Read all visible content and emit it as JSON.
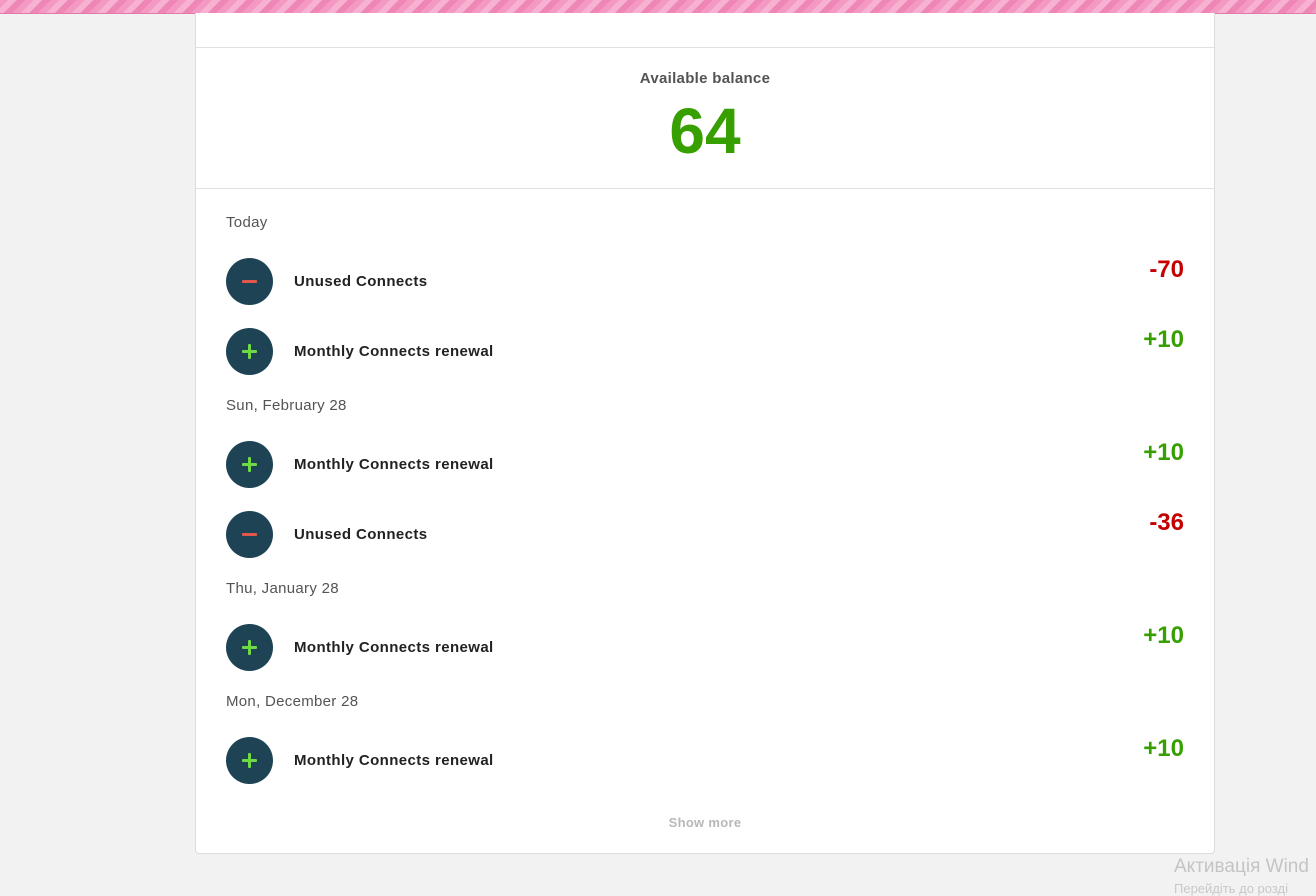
{
  "balance": {
    "label": "Available balance",
    "value": "64"
  },
  "groups": [
    {
      "date": "Today",
      "items": [
        {
          "type": "minus",
          "label": "Unused Connects",
          "amount": "-70"
        },
        {
          "type": "plus",
          "label": "Monthly Connects renewal",
          "amount": "+10"
        }
      ]
    },
    {
      "date": "Sun, February 28",
      "items": [
        {
          "type": "plus",
          "label": "Monthly Connects renewal",
          "amount": "+10"
        },
        {
          "type": "minus",
          "label": "Unused Connects",
          "amount": "-36"
        }
      ]
    },
    {
      "date": "Thu, January 28",
      "items": [
        {
          "type": "plus",
          "label": "Monthly Connects renewal",
          "amount": "+10"
        }
      ]
    },
    {
      "date": "Mon, December 28",
      "items": [
        {
          "type": "plus",
          "label": "Monthly Connects renewal",
          "amount": "+10"
        }
      ]
    }
  ],
  "show_more": "Show more",
  "watermark": {
    "title": "Активація Wind",
    "subtitle": "Перейдіть до розді"
  },
  "colors": {
    "positive": "#37a000",
    "negative": "#c50000",
    "icon_bg": "#1d4354"
  }
}
